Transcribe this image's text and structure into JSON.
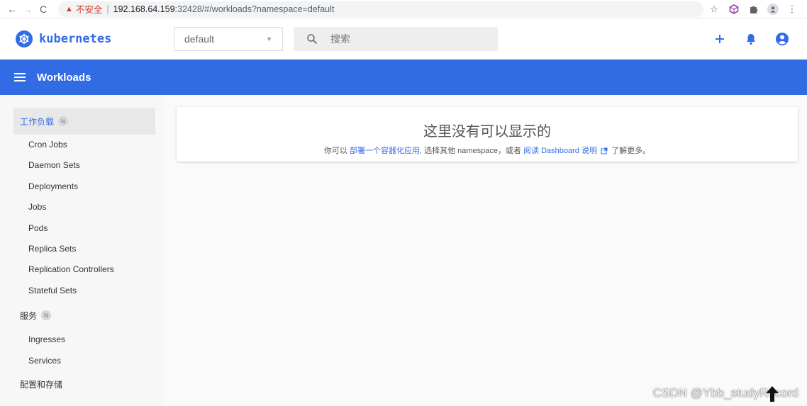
{
  "browser": {
    "nav_back": "←",
    "nav_forward": "→",
    "nav_reload": "C",
    "security_label": "不安全",
    "separator": "|",
    "url_host": "192.168.64.159",
    "url_rest": ":32428/#/workloads?namespace=default",
    "icons": [
      "star-icon",
      "extension-cube-icon",
      "puzzle-icon",
      "profile-icon",
      "kebab-menu-icon"
    ]
  },
  "header": {
    "brand": "kubernetes",
    "namespace_value": "default",
    "search_placeholder": "搜索"
  },
  "toolbar": {
    "title": "Workloads"
  },
  "sidebar": {
    "workloads": {
      "label": "工作负载",
      "badge": "N"
    },
    "workload_items": [
      "Cron Jobs",
      "Daemon Sets",
      "Deployments",
      "Jobs",
      "Pods",
      "Replica Sets",
      "Replication Controllers",
      "Stateful Sets"
    ],
    "services": {
      "label": "服务",
      "badge": "N"
    },
    "service_items": [
      "Ingresses",
      "Services"
    ],
    "config": {
      "label": "配置和存储"
    }
  },
  "empty_state": {
    "title": "这里没有可以显示的",
    "prefix": "你可以 ",
    "deploy_link": "部署一个容器化应用",
    "middle": ", 选择其他 namespace，或者 ",
    "docs_link": "阅读 Dashboard 说明",
    "suffix": " 了解更多。"
  },
  "watermark": "CSDN @Ybb_studyRecord",
  "colors": {
    "accent": "#326ce5",
    "warning": "#d93025"
  }
}
